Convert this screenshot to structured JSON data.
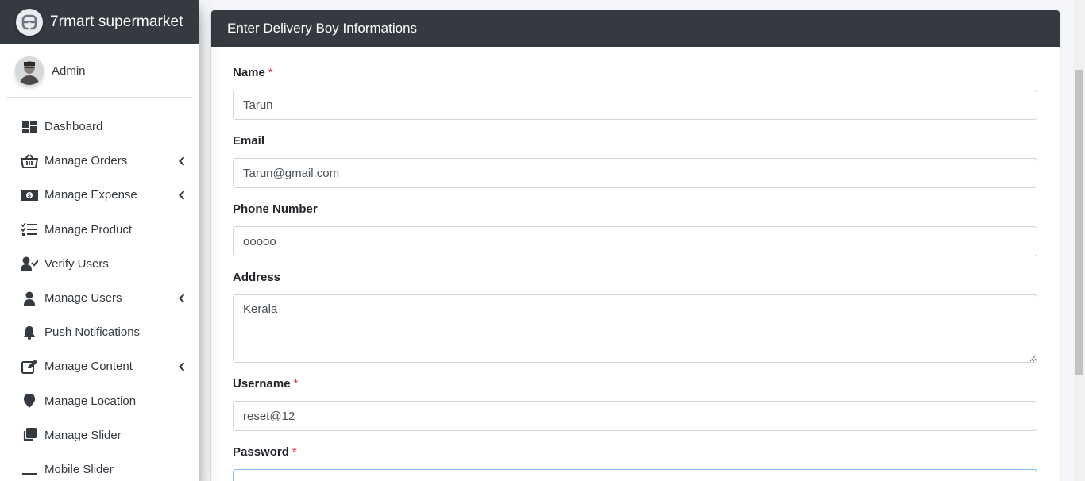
{
  "brand": {
    "name": "7rmart supermarket"
  },
  "user": {
    "name": "Admin"
  },
  "sidebar": {
    "items": [
      {
        "label": "Dashboard",
        "icon": "dashboard-icon",
        "expandable": false
      },
      {
        "label": "Manage Orders",
        "icon": "basket-icon",
        "expandable": true
      },
      {
        "label": "Manage Expense",
        "icon": "money-bill-icon",
        "expandable": true
      },
      {
        "label": "Manage Product",
        "icon": "tasks-icon",
        "expandable": false
      },
      {
        "label": "Verify Users",
        "icon": "user-check-icon",
        "expandable": false
      },
      {
        "label": "Manage Users",
        "icon": "user-icon",
        "expandable": true
      },
      {
        "label": "Push Notifications",
        "icon": "bell-icon",
        "expandable": false
      },
      {
        "label": "Manage Content",
        "icon": "edit-icon",
        "expandable": true
      },
      {
        "label": "Manage Location",
        "icon": "map-marker-icon",
        "expandable": false
      },
      {
        "label": "Manage Slider",
        "icon": "clone-icon",
        "expandable": false
      },
      {
        "label": "Mobile Slider",
        "icon": "minus-icon",
        "expandable": false
      }
    ]
  },
  "form": {
    "title": "Enter Delivery Boy Informations",
    "name": {
      "label": "Name",
      "required_mark": "*",
      "value": "Tarun"
    },
    "email": {
      "label": "Email",
      "value": "Tarun@gmail.com"
    },
    "phone": {
      "label": "Phone Number",
      "value": "ooooo"
    },
    "address": {
      "label": "Address",
      "value": "Kerala"
    },
    "username": {
      "label": "Username",
      "required_mark": "*",
      "value": "reset@12"
    },
    "password": {
      "label": "Password",
      "required_mark": "*",
      "value": ""
    }
  },
  "colors": {
    "dark": "#343a40",
    "required": "#dc3545",
    "focus_border": "#80bdff"
  }
}
